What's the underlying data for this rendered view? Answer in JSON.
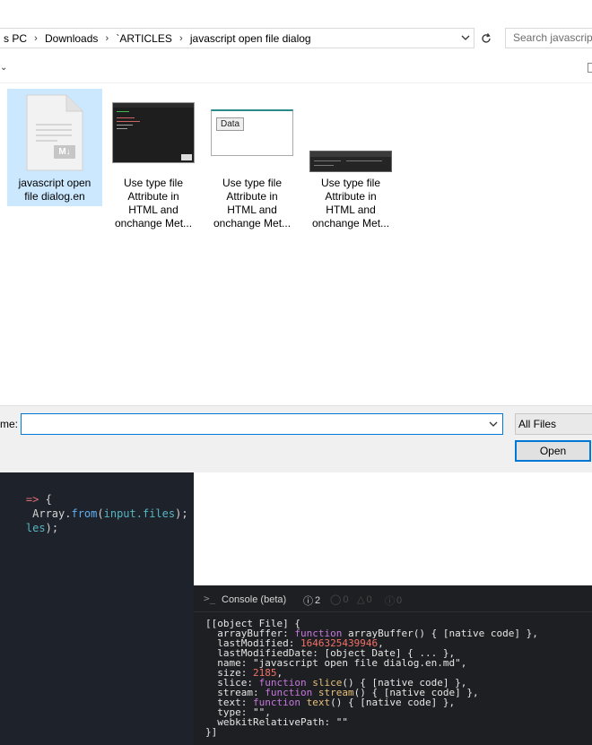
{
  "dialog": {
    "breadcrumbs": [
      "s PC",
      "Downloads",
      "`ARTICLES",
      "javascript open file dialog"
    ],
    "search_placeholder": "Search javascript",
    "files": [
      {
        "line1": "javascript open",
        "line2": "file dialog.en",
        "line3": "",
        "line4": "",
        "badge": "M↓"
      },
      {
        "line1": "Use type file",
        "line2": "Attribute in",
        "line3": "HTML and",
        "line4": "onchange Met..."
      },
      {
        "line1": "Use type file",
        "line2": "Attribute in",
        "line3": "HTML and",
        "line4": "onchange Met...",
        "thumb_button": "Data"
      },
      {
        "line1": "Use type file",
        "line2": "Attribute in",
        "line3": "HTML and",
        "line4": "onchange Met..."
      }
    ],
    "filename_label": "me:",
    "filename_value": "",
    "file_type": "All Files",
    "open_label": "Open",
    "colors": {
      "accent": "#0078d7",
      "selection": "#cce8ff"
    }
  },
  "editor": {
    "line1": {
      "arrow": "=>",
      "brace": " {"
    },
    "line2": {
      "a": " Array.",
      "b": "from",
      "c": "(",
      "d": "input.files",
      "e": ");"
    },
    "line3": {
      "a": "les",
      "b": ");"
    }
  },
  "console": {
    "prompt_glyph": ">_",
    "tab_label": "Console (beta)",
    "errors_count": "2",
    "warnings_count": "0",
    "alerts_count": "0",
    "info_count": "0",
    "output": {
      "l1": "[[object File] {",
      "ab_key": "  arrayBuffer: ",
      "ab_kw": "function",
      "ab_name": " arrayBuffer",
      "ab_rest": "() { [native code] },",
      "lm_key": "  lastModified: ",
      "lm_val": "1646325439946",
      "lm_end": ",",
      "lmd": "  lastModifiedDate: [object Date] { ... },",
      "name_key": "  name: ",
      "name_val": "\"javascript open file dialog.en.md\"",
      "name_end": ",",
      "size_key": "  size: ",
      "size_val": "2185",
      "size_end": ",",
      "slice_key": "  slice: ",
      "slice_kw": "function",
      "slice_fn": " slice",
      "slice_rest": "() { [native code] },",
      "stream_key": "  stream: ",
      "stream_kw": "function",
      "stream_fn": " stream",
      "stream_rest": "() { [native code] },",
      "text_key": "  text: ",
      "text_kw": "function",
      "text_fn": " text",
      "text_rest": "() { [native code] },",
      "type_line": "  type: \"\",",
      "wrp_line": "  webkitRelativePath: \"\"",
      "end": "}]"
    }
  }
}
